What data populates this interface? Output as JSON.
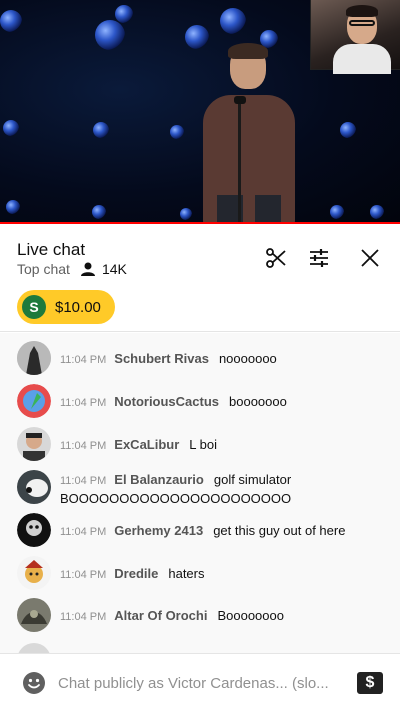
{
  "header": {
    "title": "Live chat",
    "mode": "Top chat",
    "viewer_count": "14K"
  },
  "ticker": {
    "avatar_letter": "S",
    "amount": "$10.00"
  },
  "messages": [
    {
      "time": "11:04 PM",
      "author": "Schubert Rivas",
      "text": "nooooooo"
    },
    {
      "time": "11:04 PM",
      "author": "NotoriousCactus",
      "text": "booooooo"
    },
    {
      "time": "11:04 PM",
      "author": "ExCaLibur",
      "text": "L boi"
    },
    {
      "time": "11:04 PM",
      "author": "El Balanzaurio",
      "text": "golf simulator BOOOOOOOOOOOOOOOOOOOOOO"
    },
    {
      "time": "11:04 PM",
      "author": "Gerhemy 2413",
      "text": "get this guy out of here"
    },
    {
      "time": "11:04 PM",
      "author": "Dredile",
      "text": "haters"
    },
    {
      "time": "11:04 PM",
      "author": "Altar Of Orochi",
      "text": "Boooooooo"
    }
  ],
  "input": {
    "placeholder": "Chat publicly as Victor Cardenas... (slo..."
  },
  "icons": {
    "clip": "scissors-icon",
    "settings": "sliders-icon",
    "close": "close-icon",
    "viewers": "person-icon",
    "emoji": "smiley-icon",
    "super_chat": "dollar-icon"
  },
  "colors": {
    "accent_red": "#ff0000",
    "super_chat_yellow": "#ffca28"
  }
}
